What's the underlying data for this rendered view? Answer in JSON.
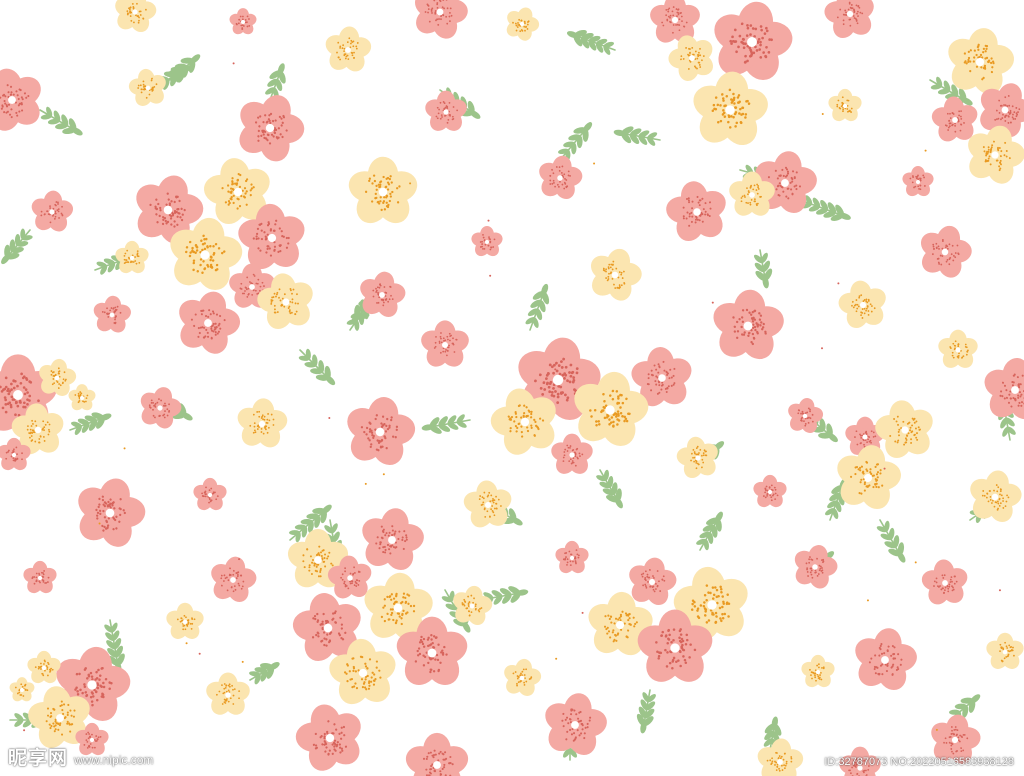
{
  "image": {
    "subject": "seamless floral pattern",
    "background_color": "#ffffff",
    "palette": {
      "pink_petal": "#f4a9a3",
      "pink_dots": "#d7645c",
      "cream_petal": "#fbe5b0",
      "cream_dots": "#e99a22",
      "leaf_green": "#9cc48a",
      "center_white": "#ffffff"
    }
  },
  "watermark": {
    "logo": "昵享网",
    "url": "www.nipic.com",
    "id_text": "ID:32787073 NO:20220516583938128"
  }
}
